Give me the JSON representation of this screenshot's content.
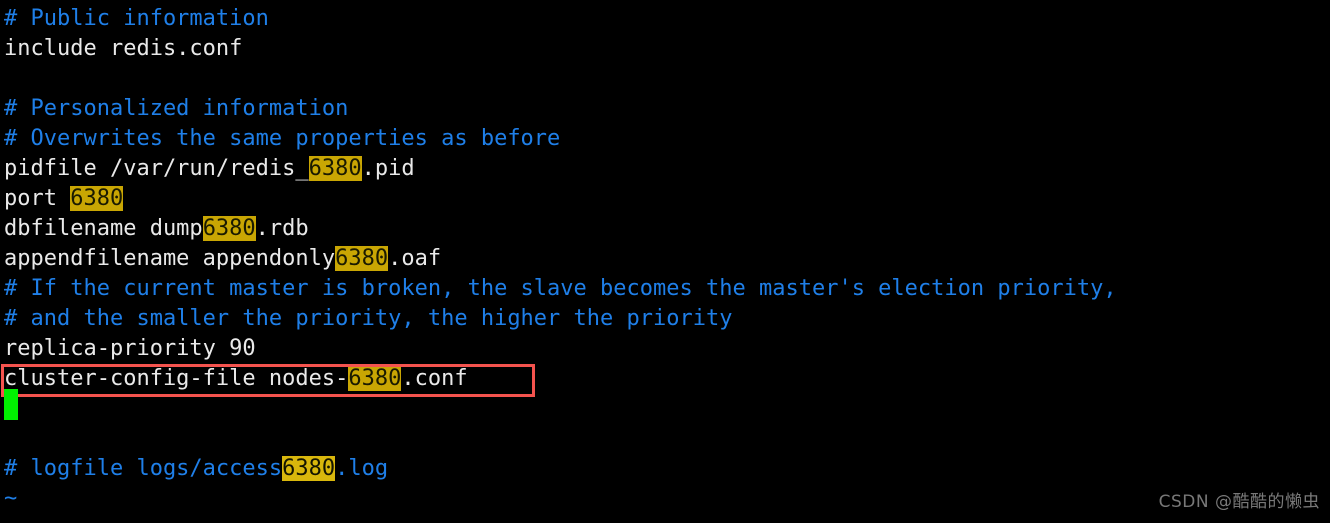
{
  "terminal": {
    "background_color": "#000000",
    "comment_color": "#1f7fe8",
    "text_color": "#e9e9e9",
    "highlight_bg": "#c9a603",
    "highlight_fg": "#1a1a00",
    "cursor_color": "#00f200",
    "box_color": "#f4534e",
    "highlight_term": "6380",
    "lines": [
      {
        "n": 0,
        "segments": [
          {
            "t": "# Public information",
            "style": "comment"
          }
        ]
      },
      {
        "n": 1,
        "segments": [
          {
            "t": "include redis.conf",
            "style": "text"
          }
        ]
      },
      {
        "n": 2,
        "segments": []
      },
      {
        "n": 3,
        "segments": [
          {
            "t": "# Personalized information",
            "style": "comment"
          }
        ]
      },
      {
        "n": 4,
        "segments": [
          {
            "t": "# Overwrites the same properties as before",
            "style": "comment"
          }
        ]
      },
      {
        "n": 5,
        "segments": [
          {
            "t": "pidfile /var/run/redis_",
            "style": "text"
          },
          {
            "t": "6380",
            "style": "highlight"
          },
          {
            "t": ".pid",
            "style": "text"
          }
        ]
      },
      {
        "n": 6,
        "segments": [
          {
            "t": "port ",
            "style": "text"
          },
          {
            "t": "6380",
            "style": "highlight"
          }
        ]
      },
      {
        "n": 7,
        "segments": [
          {
            "t": "dbfilename dump",
            "style": "text"
          },
          {
            "t": "6380",
            "style": "highlight"
          },
          {
            "t": ".rdb",
            "style": "text"
          }
        ]
      },
      {
        "n": 8,
        "segments": [
          {
            "t": "appendfilename appendonly",
            "style": "text"
          },
          {
            "t": "6380",
            "style": "highlight"
          },
          {
            "t": ".oaf",
            "style": "text"
          }
        ]
      },
      {
        "n": 9,
        "segments": [
          {
            "t": "# If the current master is broken, the slave becomes the master's election priority,",
            "style": "comment"
          }
        ]
      },
      {
        "n": 10,
        "segments": [
          {
            "t": "# and the smaller the priority, the higher the priority",
            "style": "comment"
          }
        ]
      },
      {
        "n": 11,
        "segments": [
          {
            "t": "replica-priority 90",
            "style": "text"
          }
        ]
      },
      {
        "n": 12,
        "segments": [
          {
            "t": "cluster-config-file nodes-",
            "style": "text"
          },
          {
            "t": "6380",
            "style": "highlight"
          },
          {
            "t": ".conf",
            "style": "text"
          }
        ]
      },
      {
        "n": 13,
        "segments": []
      },
      {
        "n": 14,
        "segments": []
      },
      {
        "n": 15,
        "segments": [
          {
            "t": "# logfile logs/access",
            "style": "comment"
          },
          {
            "t": "6380",
            "style": "highlight-blue"
          },
          {
            "t": ".log",
            "style": "comment"
          }
        ]
      },
      {
        "n": 16,
        "segments": [
          {
            "t": "~",
            "style": "tilde"
          }
        ]
      }
    ]
  },
  "watermark": {
    "text": "CSDN @酷酷的懒虫"
  }
}
